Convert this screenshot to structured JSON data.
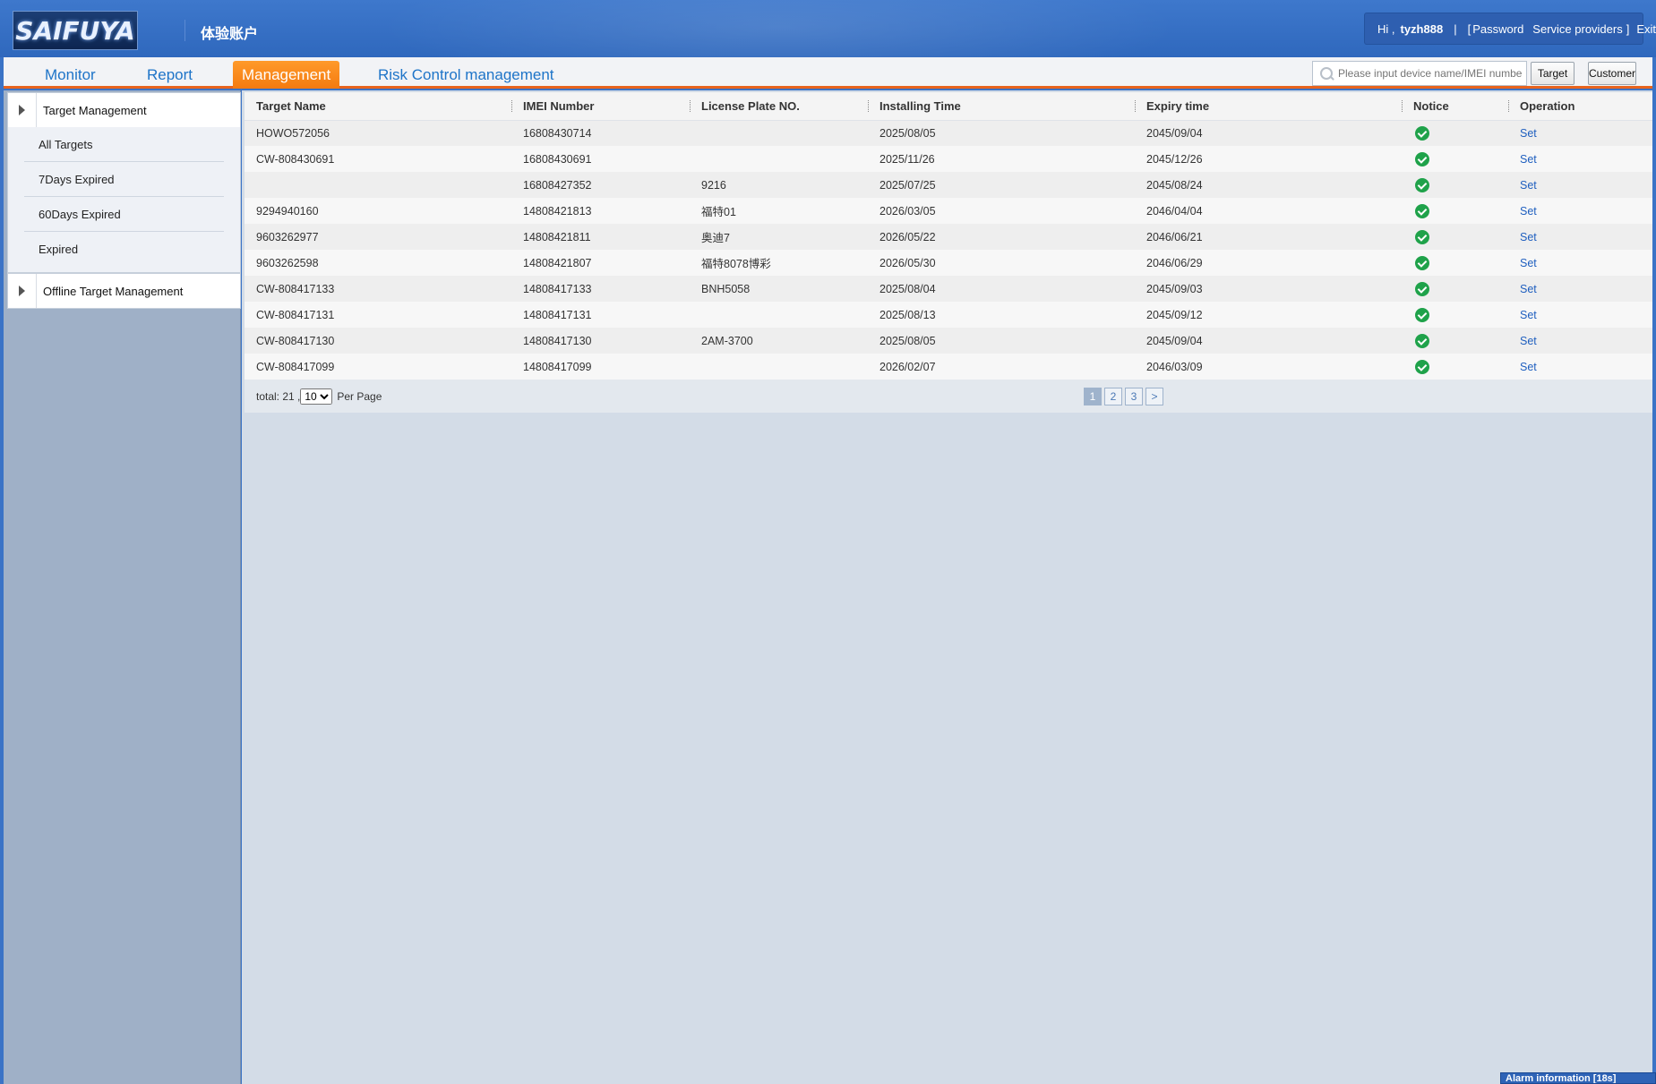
{
  "header": {
    "logo_text": "SAIFUYA",
    "account_name": "体验账户",
    "greeting": "Hi ,",
    "username": "tyzh888",
    "sep": "|",
    "bracket_open": "[",
    "password_link": "Password",
    "service_link": "Service providers",
    "bracket_close": "]",
    "exit_link": "Exit"
  },
  "nav": {
    "tabs": [
      {
        "label": "Monitor"
      },
      {
        "label": "Report"
      },
      {
        "label": "Management"
      },
      {
        "label": "Risk Control management"
      }
    ],
    "active_tab": "Management",
    "search_placeholder": "Please input device name/IMEI number",
    "target_button": "Target",
    "customer_button": "Customer"
  },
  "sidebar": {
    "target_management": "Target Management",
    "items": [
      {
        "label": "All Targets"
      },
      {
        "label": "7Days Expired"
      },
      {
        "label": "60Days Expired"
      },
      {
        "label": "Expired"
      }
    ],
    "offline_management": "Offline Target Management"
  },
  "table": {
    "columns": [
      "Target Name",
      "IMEI Number",
      "License Plate NO.",
      "Installing Time",
      "Expiry time",
      "Notice",
      "Operation"
    ],
    "rows": [
      {
        "name": "HOWO572056",
        "imei": "16808430714",
        "plate": "",
        "installing": "2025/08/05",
        "expiry": "2045/09/04",
        "op": "Set"
      },
      {
        "name": "CW-808430691",
        "imei": "16808430691",
        "plate": "",
        "installing": "2025/11/26",
        "expiry": "2045/12/26",
        "op": "Set"
      },
      {
        "name": "",
        "imei": "16808427352",
        "plate": "9216",
        "installing": "2025/07/25",
        "expiry": "2045/08/24",
        "op": "Set"
      },
      {
        "name": "9294940160",
        "imei": "14808421813",
        "plate": "福特01",
        "installing": "2026/03/05",
        "expiry": "2046/04/04",
        "op": "Set"
      },
      {
        "name": "9603262977",
        "imei": "14808421811",
        "plate": "奥迪7",
        "installing": "2026/05/22",
        "expiry": "2046/06/21",
        "op": "Set"
      },
      {
        "name": "9603262598",
        "imei": "14808421807",
        "plate": "福特8078博彩",
        "installing": "2026/05/30",
        "expiry": "2046/06/29",
        "op": "Set"
      },
      {
        "name": "CW-808417133",
        "imei": "14808417133",
        "plate": "BNH5058",
        "installing": "2025/08/04",
        "expiry": "2045/09/03",
        "op": "Set"
      },
      {
        "name": "CW-808417131",
        "imei": "14808417131",
        "plate": "",
        "installing": "2025/08/13",
        "expiry": "2045/09/12",
        "op": "Set"
      },
      {
        "name": "CW-808417130",
        "imei": "14808417130",
        "plate": "2AM-3700",
        "installing": "2025/08/05",
        "expiry": "2045/09/04",
        "op": "Set"
      },
      {
        "name": "CW-808417099",
        "imei": "14808417099",
        "plate": "",
        "installing": "2026/02/07",
        "expiry": "2046/03/09",
        "op": "Set"
      }
    ],
    "notice_icon": "check-circle-icon",
    "notice_color": "#1fa24a"
  },
  "footer": {
    "total_text": "total: 21 ,",
    "per_page_value": "10",
    "per_page_label": "Per Page",
    "pages": [
      "1",
      "2",
      "3"
    ],
    "current_page": "1",
    "next": ">"
  },
  "alarm": {
    "text": "Alarm information [18s]"
  },
  "colors": {
    "header_blue": "#3e78cc",
    "active_tab_orange": "#f47a10",
    "link_blue": "#1e74c8"
  }
}
